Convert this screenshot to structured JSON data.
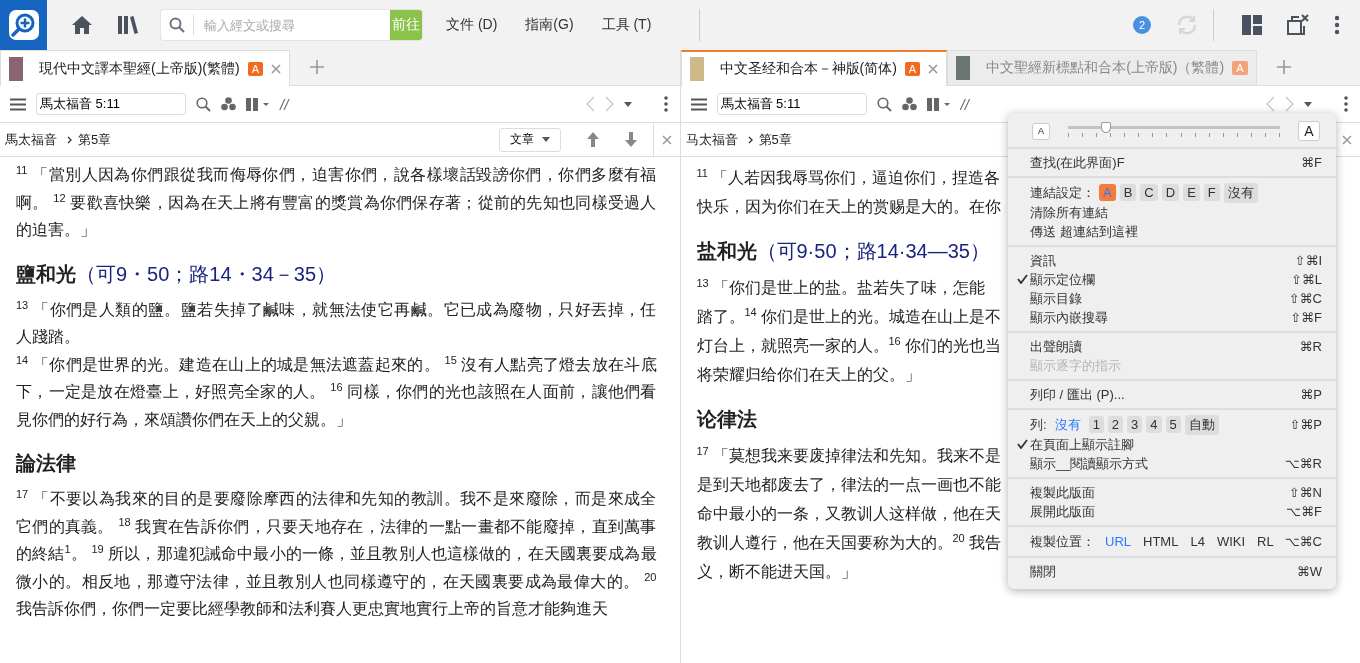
{
  "app_bar": {
    "search_placeholder": "輸入經文或搜尋",
    "go_button": "前往",
    "menus": [
      "文件 (D)",
      "指南(G)",
      "工具 (T)"
    ],
    "notification_count": "2"
  },
  "panes": [
    {
      "tabs": [
        {
          "title": "現代中文譯本聖經(上帝版)(繁體)",
          "badge": "A",
          "selected": true,
          "color": "#8a6470"
        }
      ],
      "reference": "馬太福音 5:11",
      "parallel_label": "//",
      "breadcrumb": [
        "馬太福音",
        "第5章"
      ],
      "view_dropdown": "文章",
      "content": [
        {
          "kind": "paragraph",
          "text": "$^{11}$ 「當別人因為你們跟從我而侮辱你們，迫害你們，說各樣壞話毀謗你們，你們多麼有福啊。 $^{12}$ 要歡喜快樂，因為在天上將有豐富的獎賞為你們保存著；從前的先知也同樣受過人的迫害。」"
        },
        {
          "kind": "heading",
          "title": "鹽和光",
          "ref": "（可9・50；路14・34－35）"
        },
        {
          "kind": "paragraph",
          "text": "$^{13}$ 「你們是人類的鹽。鹽若失掉了鹹味，就無法使它再鹹。它已成為廢物，只好丟掉，任人踐踏。"
        },
        {
          "kind": "paragraph",
          "text": "$^{14}$ 「你們是世界的光。建造在山上的城是無法遮蓋起來的。 $^{15}$ 沒有人點亮了燈去放在斗底下，一定是放在燈臺上，好照亮全家的人。 $^{16}$ 同樣，你們的光也該照在人面前，讓他們看見你們的好行為，來頌讚你們在天上的父親。」"
        },
        {
          "kind": "heading",
          "title": "論法律"
        },
        {
          "kind": "paragraph",
          "text": "$^{17}$ 「不要以為我來的目的是要廢除摩西的法律和先知的教訓。我不是來廢除，而是來成全它們的真義。 $^{18}$ 我實在告訴你們，只要天地存在，法律的一點一畫都不能廢掉，直到萬事的終結$^{1}$。 $^{19}$ 所以，那違犯誡命中最小的一條，並且教別人也這樣做的，在天國裏要成為最微小的。相反地，那遵守法律，並且教別人也同樣遵守的，在天國裏要成為最偉大的。 $^{20}$ 我告訴你們，你們一定要比經學教師和法利賽人更忠實地實行上帝的旨意才能夠進天"
        }
      ]
    },
    {
      "tabs": [
        {
          "title": "中文圣经和合本－神版(简体)",
          "badge": "A",
          "selected": true,
          "color": "#cdb98a"
        },
        {
          "title": "中文聖經新標點和合本(上帝版)（繁體)",
          "badge": "A",
          "selected": false,
          "color": "#6c7670"
        }
      ],
      "reference": "馬太福音 5:11",
      "parallel_label": "//",
      "breadcrumb": [
        "马太福音",
        "第5章"
      ],
      "content": [
        {
          "kind": "lines",
          "lines": [
            "$^{11}$ 「人若因我辱骂你们，逼迫你们，捏造各",
            "快乐，因为你们在天上的赏赐是大的。在你"
          ]
        },
        {
          "kind": "heading",
          "title": "盐和光",
          "ref": "（可9·50；路14·34—35）"
        },
        {
          "kind": "lines",
          "lines": [
            "$^{13}$ 「你们是世上的盐。盐若失了味，怎能",
            "踏了。$^{14}$ 你们是世上的光。城造在山上是不",
            "灯台上，就照亮一家的人。$^{16}$ 你们的光也当",
            "将荣耀归给你们在天上的父。」"
          ]
        },
        {
          "kind": "heading",
          "title": "论律法"
        },
        {
          "kind": "lines",
          "lines": [
            "$^{17}$ 「莫想我来要废掉律法和先知。我来不是",
            "是到天地都废去了，律法的一点一画也不能",
            "命中最小的一条，又教训人这样做，他在天",
            "教训人遵行，他在天国要称为大的。$^{20}$ 我告",
            "义，断不能进天国。」"
          ]
        }
      ]
    }
  ],
  "menu": {
    "font_slider": {
      "small_label": "A",
      "large_label": "A",
      "level": 0.18
    },
    "sections": [
      [
        {
          "kind": "item",
          "label": "查找(在此界面)F",
          "shortcut": "⌘F",
          "checked": false,
          "disabled": false
        }
      ],
      [
        {
          "kind": "link_chips",
          "label": "連結設定：",
          "chips": [
            {
              "label": "A",
              "selected": true
            },
            {
              "label": "B",
              "selected": false
            },
            {
              "label": "C",
              "selected": false
            },
            {
              "label": "D",
              "selected": false
            },
            {
              "label": "E",
              "selected": false
            },
            {
              "label": "F",
              "selected": false
            },
            {
              "label": "沒有",
              "selected": false
            }
          ]
        },
        {
          "kind": "item",
          "label": "清除所有連結",
          "checked": false,
          "disabled": false
        },
        {
          "kind": "item",
          "label": "傳送 超連結到這裡",
          "checked": false,
          "disabled": false
        }
      ],
      [
        {
          "kind": "item",
          "label": "資訊",
          "shortcut": "⇧⌘I",
          "checked": false,
          "disabled": false
        },
        {
          "kind": "item",
          "label": "顯示定位欄",
          "shortcut": "⇧⌘L",
          "checked": true,
          "disabled": false
        },
        {
          "kind": "item",
          "label": "顯示目錄",
          "shortcut": "⇧⌘C",
          "checked": false,
          "disabled": false
        },
        {
          "kind": "item",
          "label": "顯示內嵌搜尋",
          "shortcut": "⇧⌘F",
          "checked": false,
          "disabled": false
        }
      ],
      [
        {
          "kind": "item",
          "label": "出聲朗讀",
          "shortcut": "⌘R",
          "checked": false,
          "disabled": false
        },
        {
          "kind": "item",
          "label": "顯示逐字的指示",
          "checked": false,
          "disabled": true
        }
      ],
      [
        {
          "kind": "item",
          "label": "列印 / 匯出 (P)...",
          "shortcut": "⌘P",
          "checked": false,
          "disabled": false
        }
      ],
      [
        {
          "kind": "column_chips",
          "label": "列:",
          "shortcut": "⇧⌘P",
          "chips": [
            {
              "label": "沒有",
              "selected": true
            },
            {
              "label": "1",
              "selected": false
            },
            {
              "label": "2",
              "selected": false
            },
            {
              "label": "3",
              "selected": false
            },
            {
              "label": "4",
              "selected": false
            },
            {
              "label": "5",
              "selected": false
            },
            {
              "label": "自動",
              "selected": false
            }
          ]
        },
        {
          "kind": "item",
          "label": "在頁面上顯示註腳",
          "checked": true,
          "disabled": false
        },
        {
          "kind": "item",
          "label": "顯示__閱讀顯示方式",
          "shortcut": "⌥⌘R",
          "checked": false,
          "disabled": false
        }
      ],
      [
        {
          "kind": "item",
          "label": "複製此版面",
          "shortcut": "⇧⌘N",
          "checked": false,
          "disabled": false
        },
        {
          "kind": "item",
          "label": "展開此版面",
          "shortcut": "⌥⌘F",
          "checked": false,
          "disabled": false
        }
      ],
      [
        {
          "kind": "links",
          "label": "複製位置：",
          "shortcut": "⌥⌘C",
          "links": [
            {
              "label": "URL",
              "selected": true
            },
            {
              "label": "HTML",
              "selected": false
            },
            {
              "label": "L4",
              "selected": false
            },
            {
              "label": "WIKI",
              "selected": false
            },
            {
              "label": "RL",
              "selected": false
            }
          ]
        }
      ],
      [
        {
          "kind": "item",
          "label": "關閉",
          "shortcut": "⌘W",
          "checked": false,
          "disabled": false
        }
      ]
    ]
  }
}
